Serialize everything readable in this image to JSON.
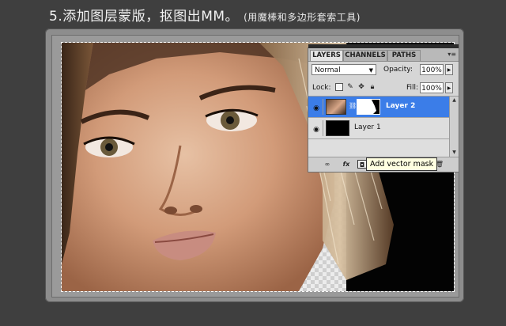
{
  "title": {
    "main": "5.添加图层蒙版，抠图出MM。",
    "sub": "(用魔棒和多边形套索工具)"
  },
  "palette": {
    "tabs": [
      "LAYERS",
      "CHANNELS",
      "PATHS"
    ],
    "blend_mode": "Normal",
    "opacity_label": "Opacity:",
    "opacity_value": "100%",
    "lock_label": "Lock:",
    "fill_label": "Fill:",
    "fill_value": "100%",
    "layers": [
      {
        "name": "Layer 2",
        "selected": true,
        "has_mask": true
      },
      {
        "name": "Layer 1",
        "selected": false,
        "has_mask": false
      }
    ],
    "tooltip": "Add vector mask",
    "bottom_icons": [
      "link-icon",
      "fx-icon",
      "vector-mask-icon",
      "trash-icon"
    ]
  },
  "colors": {
    "selection": "#3b7de8",
    "tooltip_bg": "#ffffe1",
    "page_bg": "#3f3f3f"
  }
}
